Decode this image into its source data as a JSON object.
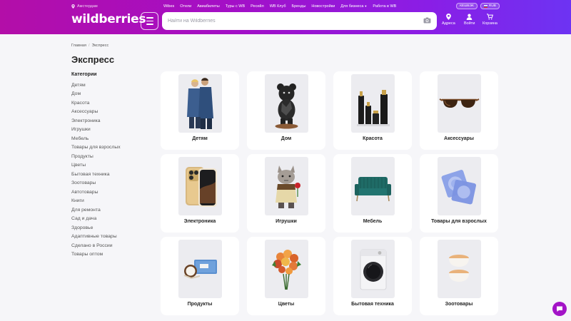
{
  "header": {
    "city": "Амстердам",
    "topnav": [
      "Wibes",
      "Отели",
      "Авиабилеты",
      "Туры с WB",
      "Ресейл",
      "WB Клуб",
      "Бренды",
      "Новостройки",
      "Для бизнеса",
      "Работа в WB"
    ],
    "pill_cashback": "КЕШБЭК",
    "pill_currency": "RUB",
    "logo": "wildberries",
    "search_placeholder": "Найти на Wildberries",
    "icons": {
      "addresses": "Адреса",
      "login": "Войти",
      "cart": "Корзина"
    }
  },
  "breadcrumb": [
    "Главная",
    "Экспресс"
  ],
  "page_title": "Экспресс",
  "sidebar": {
    "heading": "Категории",
    "items": [
      "Детям",
      "Дом",
      "Красота",
      "Аксессуары",
      "Электроника",
      "Игрушки",
      "Мебель",
      "Товары для взрослых",
      "Продукты",
      "Цветы",
      "Бытовая техника",
      "Зоотовары",
      "Автотовары",
      "Книги",
      "Для ремонта",
      "Сад и дача",
      "Здоровье",
      "Адаптивные товары",
      "Сделано в России",
      "Товары оптом"
    ]
  },
  "cards": [
    {
      "label": "Детям",
      "icon": "kids-jacket-icon"
    },
    {
      "label": "Дом",
      "icon": "bear-figurine-icon"
    },
    {
      "label": "Красота",
      "icon": "cosmetics-bottles-icon"
    },
    {
      "label": "Аксессуары",
      "icon": "sunglasses-icon"
    },
    {
      "label": "Электроника",
      "icon": "smartphone-icon"
    },
    {
      "label": "Игрушки",
      "icon": "plush-cat-icon"
    },
    {
      "label": "Мебель",
      "icon": "sofa-icon"
    },
    {
      "label": "Товары для взрослых",
      "icon": "packet-icon"
    },
    {
      "label": "Продукты",
      "icon": "coconut-chocolate-icon"
    },
    {
      "label": "Цветы",
      "icon": "flower-bouquet-icon"
    },
    {
      "label": "Бытовая техника",
      "icon": "washing-machine-icon"
    },
    {
      "label": "Зоотовары",
      "icon": "pet-bowls-icon"
    }
  ],
  "colors": {
    "brand_start": "#b30ea8",
    "brand_end": "#6d33f3",
    "page_bg": "#f6f6f9",
    "chat": "#a314c7"
  }
}
